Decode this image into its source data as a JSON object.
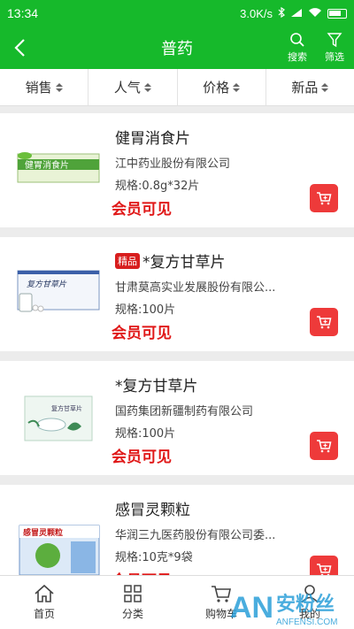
{
  "status_bar": {
    "time": "13:34",
    "network_speed": "3.0K/s"
  },
  "header": {
    "title": "普药",
    "search_label": "搜索",
    "filter_label": "筛选"
  },
  "sort_bar": [
    {
      "label": "销售"
    },
    {
      "label": "人气"
    },
    {
      "label": "价格"
    },
    {
      "label": "新品"
    }
  ],
  "products": [
    {
      "name": "健胃消食片",
      "tag": "",
      "maker": "江中药业股份有限公司",
      "spec": "规格:0.8g*32片",
      "price_text": "会员可见",
      "box_text": "健胃消食片"
    },
    {
      "name": "*复方甘草片",
      "tag": "精品",
      "maker": "甘肃莫高实业发展股份有限公...",
      "spec": "规格:100片",
      "price_text": "会员可见",
      "box_text": "复方甘草片"
    },
    {
      "name": "*复方甘草片",
      "tag": "",
      "maker": "国药集团新疆制药有限公司",
      "spec": "规格:100片",
      "price_text": "会员可见",
      "box_text": "复方甘草片"
    },
    {
      "name": "感冒灵颗粒",
      "tag": "",
      "maker": "华润三九医药股份有限公司委...",
      "spec": "规格:10克*9袋",
      "price_text": "会员可见",
      "box_text": "感冒灵颗粒"
    }
  ],
  "tab_bar": [
    {
      "label": "首页"
    },
    {
      "label": "分类"
    },
    {
      "label": "购物车"
    },
    {
      "label": "我的"
    }
  ],
  "watermark": {
    "text": "安粉丝",
    "brand": "AN",
    "url": "ANFENSI.COM"
  },
  "colors": {
    "brand_green": "#16b92b",
    "price_red": "#e01818",
    "cart_red": "#ee3a3a"
  }
}
